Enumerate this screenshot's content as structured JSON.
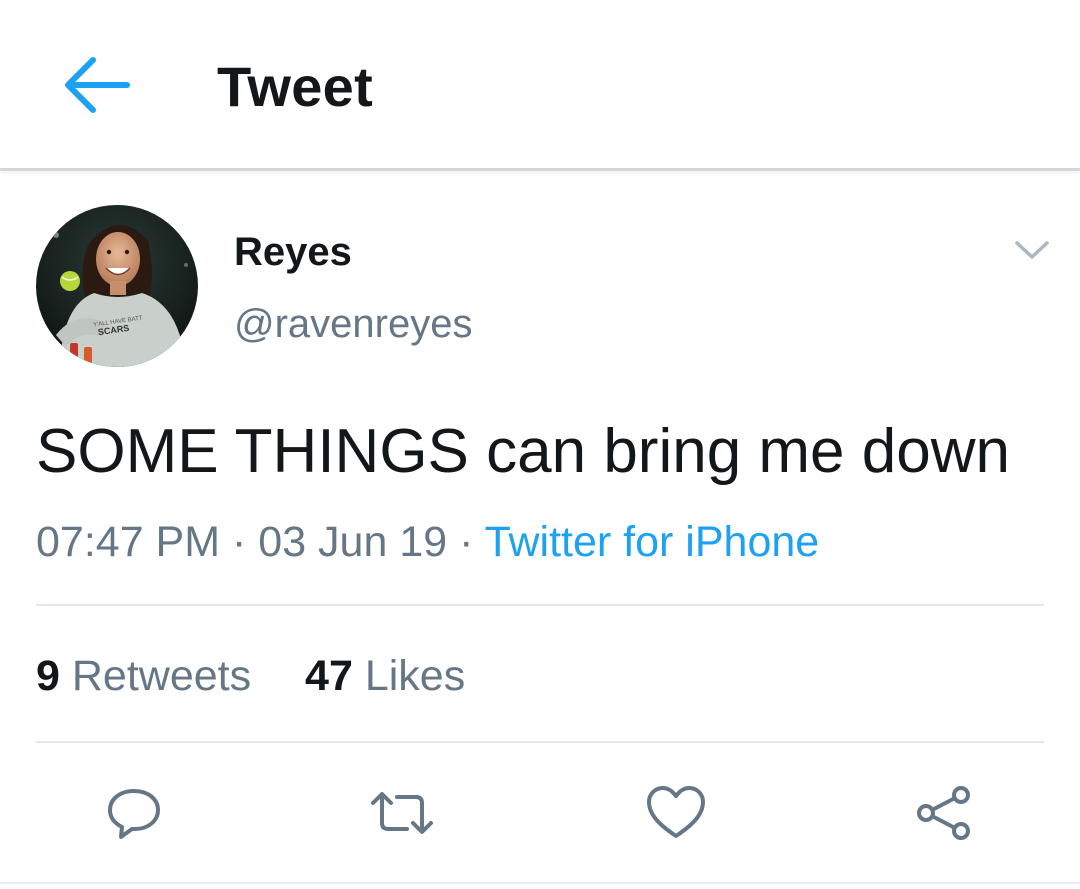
{
  "header": {
    "title": "Tweet",
    "back_icon": "arrow-left-icon",
    "accent_color": "#1da1f2"
  },
  "tweet": {
    "author": {
      "display_name": "Reyes",
      "handle": "@ravenreyes",
      "avatar_shirt_text_line1": "Y'ALL HAVE BATT",
      "avatar_shirt_text_line2": "SCARS"
    },
    "text": "SOME THINGS can bring me down",
    "time": "07:47 PM",
    "separator": " · ",
    "date": "03 Jun 19",
    "source": "Twitter for iPhone",
    "menu_icon": "chevron-down-icon"
  },
  "stats": {
    "retweets_count": "9",
    "retweets_label": "Retweets",
    "likes_count": "47",
    "likes_label": "Likes"
  },
  "actions": [
    {
      "icon": "reply-icon"
    },
    {
      "icon": "retweet-icon"
    },
    {
      "icon": "heart-icon"
    },
    {
      "icon": "share-icon"
    }
  ],
  "colors": {
    "primary_text": "#14171a",
    "secondary_text": "#657786",
    "link": "#1da1f2",
    "divider": "#e1e8ed"
  }
}
